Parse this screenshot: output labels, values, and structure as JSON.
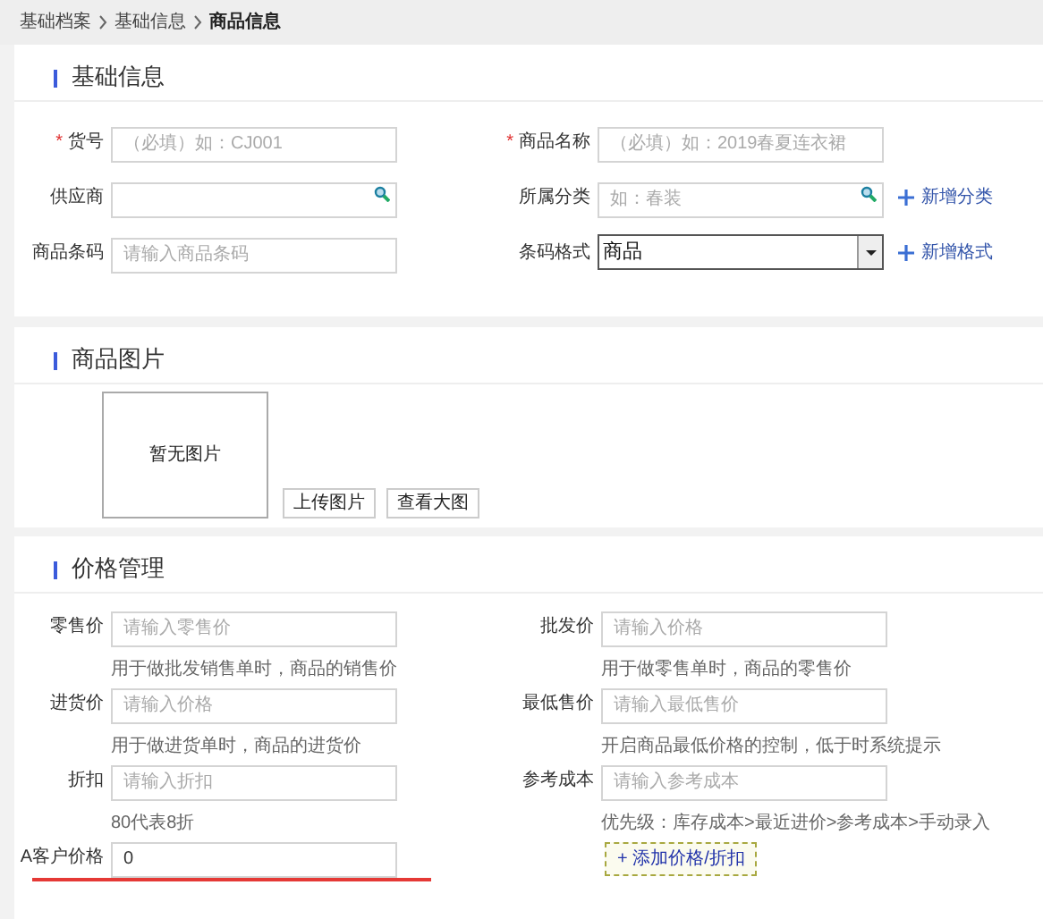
{
  "breadcrumb": [
    "基础档案",
    "基础信息",
    "商品信息"
  ],
  "basic_info": {
    "title": "基础信息",
    "fields": [
      {
        "label": "货号",
        "required_mark": "*",
        "kind": "text",
        "placeholder": "（必填）如：CJ001"
      },
      {
        "label": "商品名称",
        "required_mark": "*",
        "kind": "text",
        "placeholder": "（必填）如：2019春夏连衣裙"
      },
      {
        "label": "供应商",
        "kind": "search"
      },
      {
        "label": "所属分类",
        "kind": "search",
        "placeholder": "如：春装",
        "action": "新增分类"
      },
      {
        "label": "商品条码",
        "kind": "text",
        "placeholder": "请输入商品条码"
      },
      {
        "label": "条码格式",
        "kind": "select",
        "value": "商品",
        "action": "新增格式"
      }
    ]
  },
  "images": {
    "title": "商品图片",
    "empty_text": "暂无图片",
    "buttons": [
      "上传图片",
      "查看大图"
    ]
  },
  "pricing": {
    "title": "价格管理",
    "fields": [
      {
        "label": "零售价",
        "placeholder": "请输入零售价",
        "hint": "用于做批发销售单时，商品的销售价",
        "underlined": false
      },
      {
        "label": "批发价",
        "placeholder": "请输入价格",
        "hint": "用于做零售单时，商品的零售价",
        "underlined": false
      },
      {
        "label": "进货价",
        "placeholder": "请输入价格",
        "hint": "用于做进货单时，商品的进货价",
        "underlined": false
      },
      {
        "label": "最低售价",
        "placeholder": "请输入最低售价",
        "hint": "开启商品最低价格的控制，低于时系统提示",
        "underlined": false
      },
      {
        "label": "折扣",
        "placeholder": "请输入折扣",
        "hint": "80代表8折",
        "underlined": false
      },
      {
        "label": "参考成本",
        "placeholder": "请输入参考成本",
        "hint": "优先级：库存成本>最近进价>参考成本>手动录入",
        "underlined": false
      },
      {
        "label": "A客户价格",
        "value": "0",
        "underlined": true
      }
    ],
    "add_button": "+ 添加价格/折扣"
  }
}
